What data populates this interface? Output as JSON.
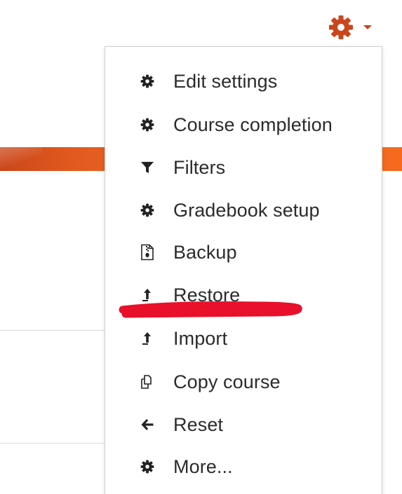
{
  "gear_menu": {
    "trigger_icon": "gear-icon",
    "trigger_caret_icon": "caret-down-icon",
    "accent_color": "#c9471a",
    "items": [
      {
        "label": "Edit settings",
        "icon": "gear-icon"
      },
      {
        "label": "Course completion",
        "icon": "gear-icon"
      },
      {
        "label": "Filters",
        "icon": "filter-icon"
      },
      {
        "label": "Gradebook setup",
        "icon": "gear-icon"
      },
      {
        "label": "Backup",
        "icon": "file-archive-icon"
      },
      {
        "label": "Restore",
        "icon": "upload-arrow-icon"
      },
      {
        "label": "Import",
        "icon": "upload-arrow-icon"
      },
      {
        "label": "Copy course",
        "icon": "copy-icon"
      },
      {
        "label": "Reset",
        "icon": "arrow-left-icon"
      },
      {
        "label": "More...",
        "icon": "gear-icon"
      }
    ]
  },
  "annotation": {
    "type": "red-underline",
    "target": "Restore",
    "color": "#e8102a"
  },
  "background": {
    "banner_color": "#ee6b25"
  }
}
